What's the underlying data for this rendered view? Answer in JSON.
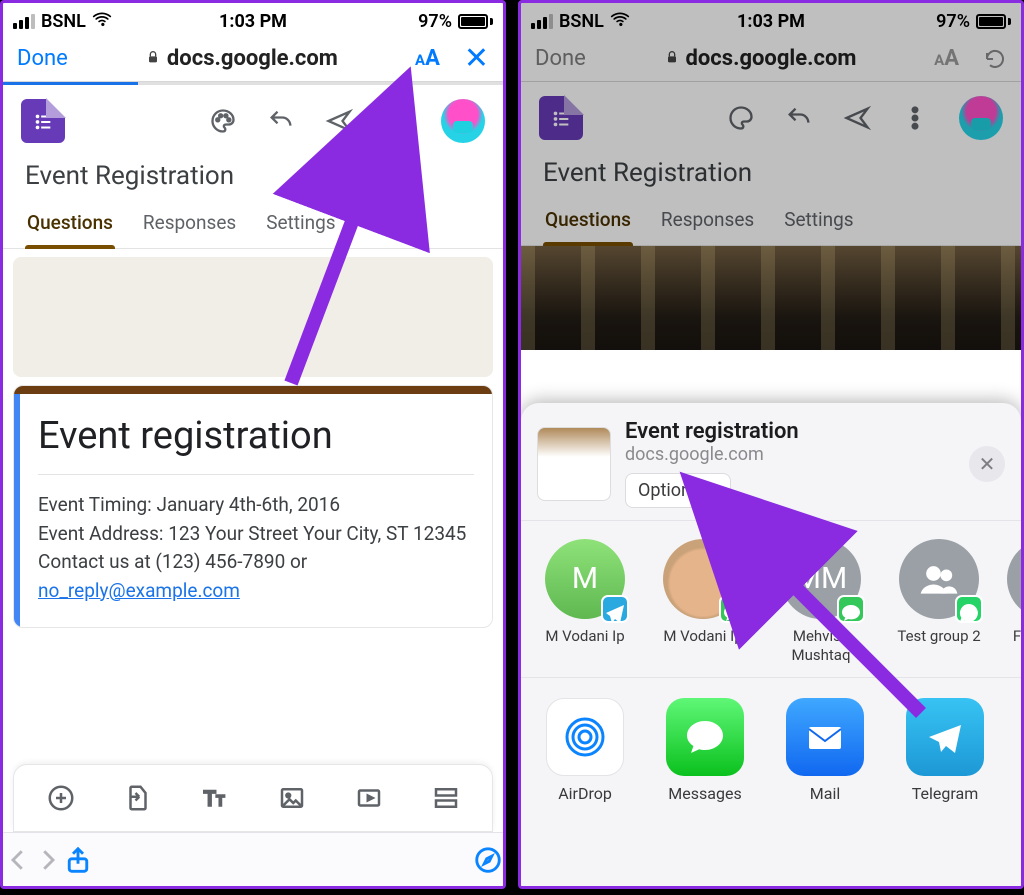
{
  "status": {
    "carrier": "BSNL",
    "time": "1:03 PM",
    "battery": "97%"
  },
  "safari": {
    "done": "Done",
    "url": "docs.google.com",
    "aa": "AA"
  },
  "forms": {
    "title": "Event Registration",
    "tabs": {
      "questions": "Questions",
      "responses": "Responses",
      "settings": "Settings"
    },
    "card_title": "Event registration",
    "desc_line1": "Event Timing: January 4th-6th, 2016",
    "desc_line2": "Event Address: 123 Your Street Your City, ST 12345",
    "desc_line3_pre": "Contact us at (123) 456-7890 or ",
    "desc_email": "no_reply@example.com"
  },
  "sheet": {
    "title": "Event registration",
    "sub": "docs.google.com",
    "options": "Options",
    "contacts": [
      {
        "name": "M Vodani Ip",
        "style": "green",
        "initial": "M",
        "badge": "tg"
      },
      {
        "name": "M Vodani Ip",
        "style": "photo",
        "initial": "",
        "badge": "im"
      },
      {
        "name": "Mehvish Mushtaq",
        "style": "grey",
        "initial": "MM",
        "badge": "im"
      },
      {
        "name": "Test group 2",
        "style": "grey",
        "initial": "",
        "badge": "wa",
        "group": true
      }
    ],
    "apps": {
      "airdrop": "AirDrop",
      "messages": "Messages",
      "mail": "Mail",
      "telegram": "Telegram"
    }
  }
}
